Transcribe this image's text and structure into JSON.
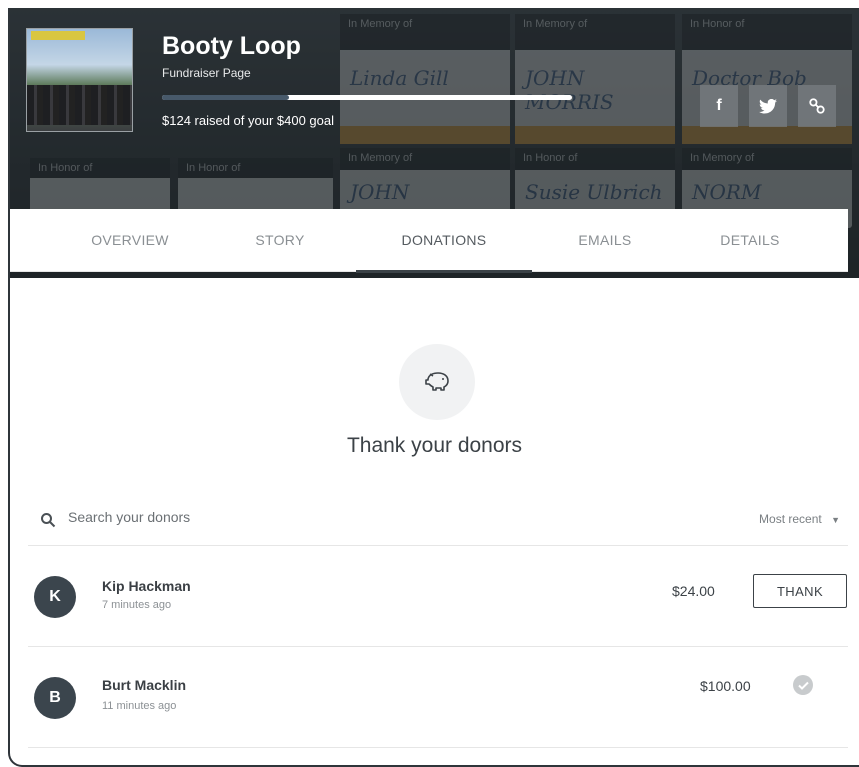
{
  "header": {
    "title": "Booty Loop",
    "subtitle": "Fundraiser Page",
    "progress_fraction": 0.31,
    "raised_text": "$124 raised of your $400 goal",
    "share_buttons": [
      {
        "icon": "facebook-icon",
        "label": "f"
      },
      {
        "icon": "twitter-icon"
      },
      {
        "icon": "link-icon"
      }
    ],
    "background_signs": [
      {
        "text": "In Memory of",
        "hand": "Linda Gill"
      },
      {
        "text": "In Memory of",
        "hand": "JOHN MORRIS"
      },
      {
        "text": "In Honor of",
        "hand": "Doctor Bob"
      },
      {
        "text": "In Memory of",
        "hand": "JOHN"
      },
      {
        "text": "In Honor of",
        "hand": "Susie Ulbrich"
      },
      {
        "text": "In Memory of",
        "hand": "NORM"
      },
      {
        "text": "In Honor of",
        "hand": ""
      },
      {
        "text": "In Honor of",
        "hand": ""
      }
    ]
  },
  "tabs": [
    {
      "label": "OVERVIEW",
      "active": false
    },
    {
      "label": "STORY",
      "active": false
    },
    {
      "label": "DONATIONS",
      "active": true
    },
    {
      "label": "EMAILS",
      "active": false
    },
    {
      "label": "DETAILS",
      "active": false
    }
  ],
  "donations": {
    "empty_icon": "piggy-bank-icon",
    "heading": "Thank your donors",
    "search_placeholder": "Search your donors",
    "sort_label": "Most recent",
    "donors": [
      {
        "initial": "K",
        "name": "Kip Hackman",
        "time": "7 minutes ago",
        "amount": "$24.00",
        "thanked": false,
        "action_label": "THANK"
      },
      {
        "initial": "B",
        "name": "Burt Macklin",
        "time": "11 minutes ago",
        "amount": "$100.00",
        "thanked": true,
        "action_label": ""
      }
    ]
  },
  "colors": {
    "dark": "#3b454d",
    "active_tab_underline": "#3b4247",
    "thanked_check": "#c8cbcd"
  }
}
